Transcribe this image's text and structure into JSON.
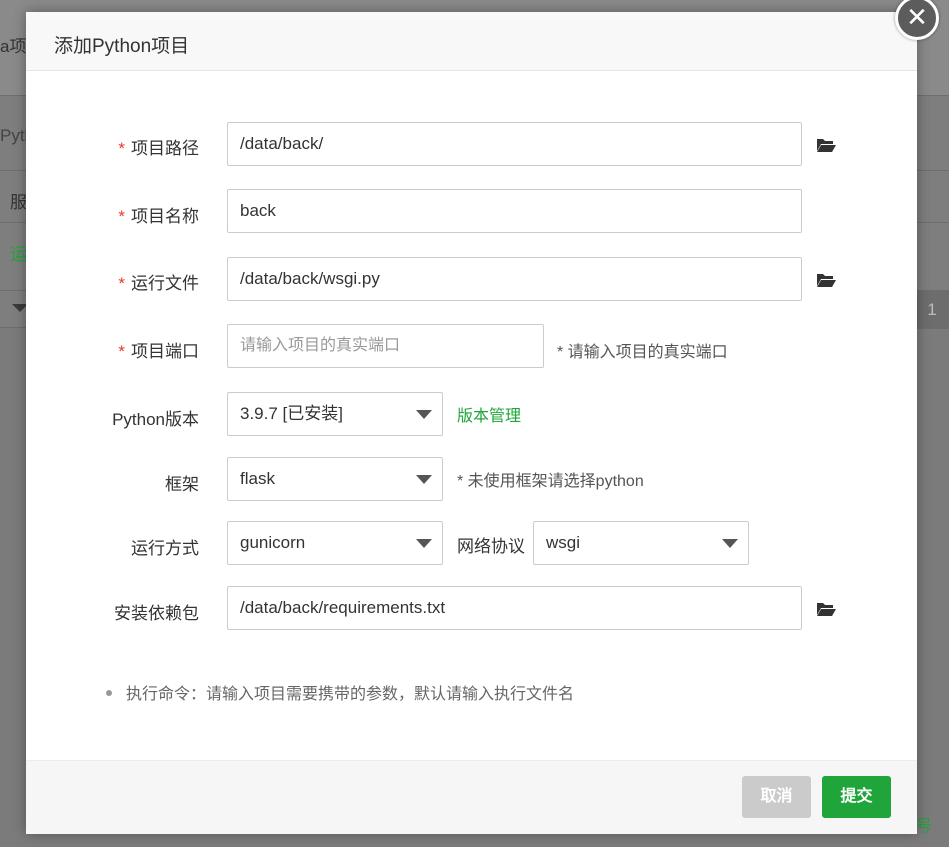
{
  "background": {
    "frag_title": "a项",
    "frag_tab": "Pyth",
    "frag_col": "服",
    "frag_status": "运",
    "pager_value": "1",
    "frag_bottom": "众号"
  },
  "dialog": {
    "title": "添加Python项目",
    "close_icon": "close-icon",
    "fields": {
      "project_path": {
        "label": "项目路径",
        "required": "*",
        "value": "/data/back/"
      },
      "project_name": {
        "label": "项目名称",
        "required": "*",
        "value": "back"
      },
      "run_file": {
        "label": "运行文件",
        "required": "*",
        "value": "/data/back/wsgi.py"
      },
      "project_port": {
        "label": "项目端口",
        "required": "*",
        "placeholder": "请输入项目的真实端口",
        "hint": "* 请输入项目的真实端口"
      },
      "python_version": {
        "label": "Python版本",
        "value": "3.9.7 [已安装]",
        "link": "版本管理"
      },
      "framework": {
        "label": "框架",
        "value": "flask",
        "hint": "* 未使用框架请选择python"
      },
      "run_mode": {
        "label": "运行方式",
        "value": "gunicorn",
        "protocol_label": "网络协议",
        "protocol_value": "wsgi"
      },
      "install_deps": {
        "label": "安装依赖包",
        "value": "/data/back/requirements.txt"
      }
    },
    "note": "执行命令：请输入项目需要携带的参数，默认请输入执行文件名",
    "buttons": {
      "cancel": "取消",
      "submit": "提交"
    }
  },
  "colors": {
    "accent": "#20a53a",
    "required": "#e8382c",
    "cancel_bg": "#cbcbcb"
  }
}
